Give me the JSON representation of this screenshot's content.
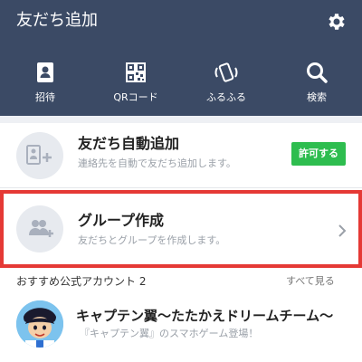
{
  "header": {
    "title": "友だち追加",
    "settings_icon": "gear-icon",
    "background": "#3b4a65"
  },
  "actions": [
    {
      "label": "招待",
      "icon": "address-book-icon"
    },
    {
      "label": "QRコード",
      "icon": "qr-code-icon"
    },
    {
      "label": "ふるふる",
      "icon": "shake-phone-icon"
    },
    {
      "label": "検索",
      "icon": "search-icon"
    }
  ],
  "auto_add": {
    "title": "友だち自動追加",
    "subtitle": "連絡先を自動で友だち追加します。",
    "button_label": "許可する",
    "icon": "phone-add-icon",
    "button_color": "#2ebd4f"
  },
  "group": {
    "title": "グループ作成",
    "subtitle": "友だちとグループを作成します。",
    "icon": "group-add-icon",
    "highlight_color": "#e53935"
  },
  "recommended": {
    "title": "おすすめ公式アカウント",
    "count": "2",
    "see_all": "すべて見る"
  },
  "official_account": {
    "title": "キャプテン翼〜たたかえドリームチーム〜",
    "subtitle": "『キャプテン翼』のスマホゲーム登場！"
  }
}
